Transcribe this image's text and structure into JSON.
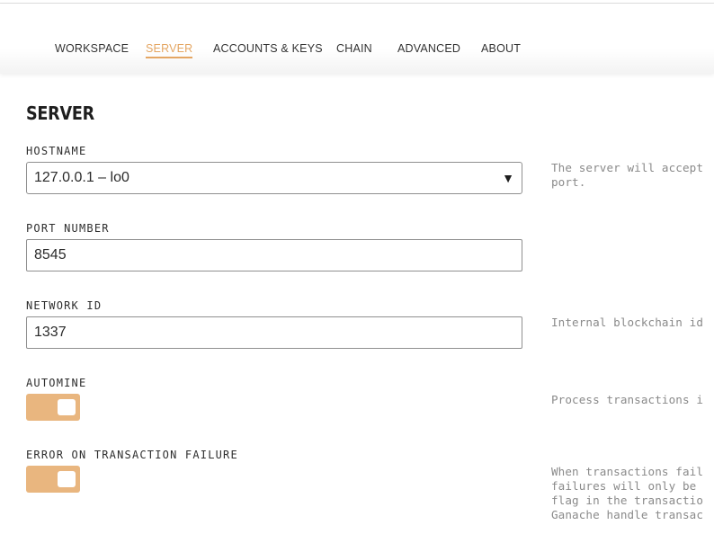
{
  "nav": {
    "tabs": [
      {
        "label": "WORKSPACE",
        "active": false
      },
      {
        "label": "SERVER",
        "active": true
      },
      {
        "label": "ACCOUNTS & KEYS",
        "active": false
      },
      {
        "label": "CHAIN",
        "active": false
      },
      {
        "label": "ADVANCED",
        "active": false
      },
      {
        "label": "ABOUT",
        "active": false
      }
    ],
    "accent_color": "#e4a663"
  },
  "server": {
    "title": "SERVER",
    "hostname": {
      "label": "HOSTNAME",
      "value": "127.0.0.1 – lo0",
      "help": "The server will accept\nport."
    },
    "port": {
      "label": "PORT NUMBER",
      "value": "8545"
    },
    "network_id": {
      "label": "NETWORK ID",
      "value": "1337",
      "help": "Internal blockchain id"
    },
    "automine": {
      "label": "AUTOMINE",
      "on": true,
      "help": "Process transactions i"
    },
    "error_on_failure": {
      "label": "ERROR ON TRANSACTION FAILURE",
      "on": true,
      "help": "When transactions fail\nfailures will only be\nflag in the transactio\nGanache handle transac"
    },
    "toggle_color": "#e9b67f"
  }
}
